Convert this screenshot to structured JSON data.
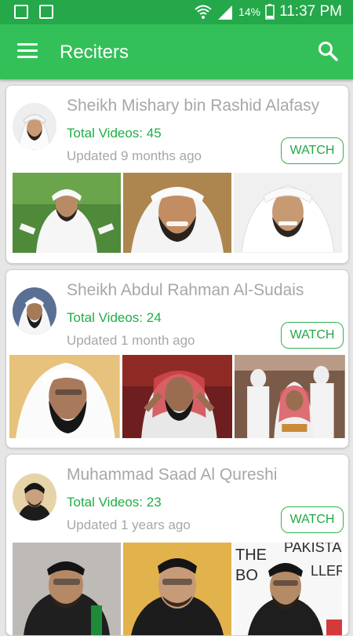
{
  "status_bar": {
    "battery": "14%",
    "time": "11:37 PM",
    "icons": [
      "message-icon",
      "image-icon",
      "wifi-icon",
      "signal-icon",
      "battery-icon"
    ]
  },
  "app_bar": {
    "title": "Reciters",
    "icons": [
      "menu-icon",
      "search-icon"
    ]
  },
  "reciters": [
    {
      "name": "Sheikh Mishary bin Rashid Alafasy",
      "total_videos": "Total Videos: 45",
      "updated": "Updated 9 months ago",
      "watch_label": "WATCH"
    },
    {
      "name": "Sheikh Abdul Rahman Al-Sudais",
      "total_videos": "Total Videos: 24",
      "updated": "Updated 1 month ago",
      "watch_label": "WATCH"
    },
    {
      "name": "Muhammad Saad Al Qureshi",
      "total_videos": "Total Videos: 23",
      "updated": "Updated 1 years ago",
      "watch_label": "WATCH"
    }
  ],
  "thumbnail_overlay": {
    "banner_line1": "THE",
    "banner_line2": "PAKISTAN",
    "banner_line3": "BO",
    "banner_line4": "LLER"
  },
  "colors": {
    "status_bar": "#24a84a",
    "app_bar": "#34c058",
    "accent_text": "#1fae44",
    "muted_text": "#a7a7a7",
    "background": "#e6e6e6"
  }
}
